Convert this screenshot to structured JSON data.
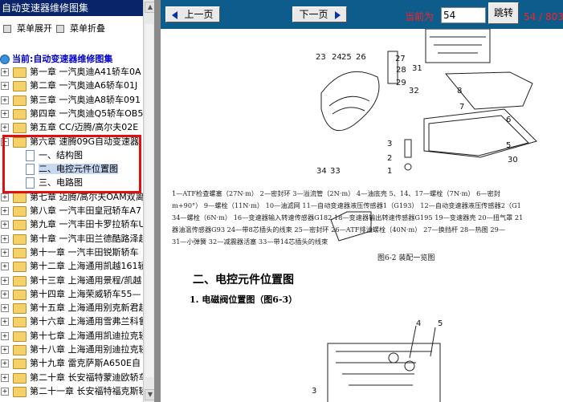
{
  "sidebar": {
    "title": "自动变速器维修图集",
    "expand_label": "菜单展开",
    "collapse_label": "菜单折叠",
    "current_label": "当前:自动变速器维修图集",
    "chapters": [
      {
        "label": "第一章 一汽奥迪A41轿车0A"
      },
      {
        "label": "第二章 一汽奥迪A6轿车01J"
      },
      {
        "label": "第三章 一汽奥迪A8轿车091"
      },
      {
        "label": "第四章 一汽奥迪Q5轿车OB5"
      },
      {
        "label": "第五章 CC/迈腾/高尔夫02E"
      },
      {
        "label": "第六章 速腾09G自动变速器"
      },
      {
        "label": "第七章 迈腾/高尔夫OAM双离"
      },
      {
        "label": "第八章 一汽丰田皇冠轿车A7"
      },
      {
        "label": "第九章 一汽丰田卡罗拉轿车U"
      },
      {
        "label": "第十章 一汽丰田兰德酷路泽越"
      },
      {
        "label": "第十一章 一汽丰田锐斯轿车"
      },
      {
        "label": "第十二章 上海通用凯越161轿"
      },
      {
        "label": "第十三章 上海通用景程/凯越"
      },
      {
        "label": "第十四章 上海荣威轿车55—"
      },
      {
        "label": "第十五章 上海通用别克新君越"
      },
      {
        "label": "第十六章 上海通用雪弗兰科鲁"
      },
      {
        "label": "第十七章 上海通用凯迪拉克轿"
      },
      {
        "label": "第十八章 上海通用别迪拉克轿"
      },
      {
        "label": "第十九章 雷克萨斯A650E自"
      },
      {
        "label": "第二十章 长安福特蒙迪欧轿车"
      },
      {
        "label": "第二十一章 长安福特福克斯轿"
      }
    ],
    "sub_items": [
      {
        "label": "一、结构图"
      },
      {
        "label": "二、电控元件位置图"
      },
      {
        "label": "三、电路图"
      }
    ]
  },
  "toolbar": {
    "prev_label": "上一页",
    "next_label": "下一页",
    "current_page_label": "当前为",
    "page_value": "54",
    "goto_label": "跳转",
    "total_label": "54 / 803"
  },
  "document": {
    "callouts": [
      "23",
      "24",
      "25",
      "26",
      "27",
      "28",
      "29",
      "31",
      "32",
      "8",
      "7",
      "6",
      "5",
      "3",
      "2",
      "1",
      "34",
      "33",
      "30",
      "4",
      "5",
      "3"
    ],
    "legend_lines": [
      "1—ATF检查螺塞（27N·m）  2—密封环  3—溢流管（2N·m）  4—油底壳  5、14、17—螺栓（7N·m）  6—密封",
      "m+90°）  9—螺栓（11N·m）  10—油滤网  11—自动变速器液压传感器1（G193）  12—自动变速器液压传感器2（G1",
      "34—螺栓（6N·m）  16—变速器输入转速传感器G182  18—变速器输出转速传感器G195  19—变速器壳  20—扭气罩  21",
      "器油温传感器G93  24—带8芯插头的线束  25—密封环  26—ATF排油螺栓（40N·m）  27—换挡杆  28—热图  29—",
      "31—小弹簧  32—减震器活塞  33—带14芯插头的线束"
    ],
    "figure_caption": "图6-2   装配一览图",
    "section_heading": "二、电控元件位置图",
    "subsection_heading": "1. 电磁阀位置图（图6-3）"
  }
}
